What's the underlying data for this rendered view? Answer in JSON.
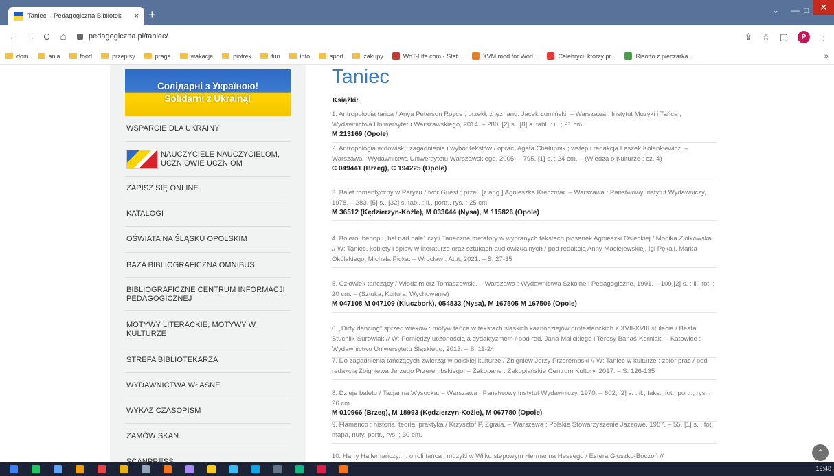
{
  "tab": {
    "title": "Taniec – Pedagogiczna Bibliotek",
    "close": "×",
    "new_tab": "+"
  },
  "window": {
    "minimize": "—",
    "maximize": "□",
    "close": "✕",
    "chevron": "⌄"
  },
  "nav": {
    "back": "←",
    "forward": "→",
    "reload": "C",
    "home": "⌂"
  },
  "address": {
    "url": "pedagogiczna.pl/taniec/"
  },
  "toolbar": {
    "share": "⇪",
    "star": "☆",
    "panel": "▢",
    "profile": "P",
    "menu": "⋮"
  },
  "bookmarks": [
    {
      "label": "dom",
      "type": "folder"
    },
    {
      "label": "ania",
      "type": "folder"
    },
    {
      "label": "food",
      "type": "folder"
    },
    {
      "label": "przepisy",
      "type": "folder"
    },
    {
      "label": "praga",
      "type": "folder"
    },
    {
      "label": "wakacje",
      "type": "folder"
    },
    {
      "label": "piotrek",
      "type": "folder"
    },
    {
      "label": "fun",
      "type": "folder"
    },
    {
      "label": "info",
      "type": "folder"
    },
    {
      "label": "sport",
      "type": "folder"
    },
    {
      "label": "zakupy",
      "type": "folder"
    },
    {
      "label": "WoT-Life.com - Stat...",
      "type": "site",
      "color": "#c0392b"
    },
    {
      "label": "XVM mod for Worl...",
      "type": "site",
      "color": "#e67e22"
    },
    {
      "label": "Celebryci, którzy pr...",
      "type": "site",
      "color": "#e53935"
    },
    {
      "label": "Risotto z pieczarka...",
      "type": "site",
      "color": "#43a047"
    }
  ],
  "bookmarks_more": "»",
  "banner": {
    "line1": "Солідарні з Україною!",
    "line2": "Solidarni z Ukrainą!"
  },
  "menu": [
    {
      "label": "WSPARCIE DLA UKRAINY",
      "h": 38
    },
    {
      "label": "NAUCZYCIELE NAUCZYCIELOM, UCZNIOWIE UCZNIOM",
      "h": 50,
      "flag": true
    },
    {
      "label": "ZAPISZ SIĘ ONLINE",
      "h": 36
    },
    {
      "label": "KATALOGI",
      "h": 37
    },
    {
      "label": "OŚWIATA NA ŚLĄSKU OPOLSKIM",
      "h": 38
    },
    {
      "label": "BAZA BIBLIOGRAFICZNA OMNIBUS",
      "h": 37
    },
    {
      "label": "BIBLIOGRAFICZNE CENTRUM INFORMACJI PEDAGOGICZNEJ",
      "h": 48
    },
    {
      "label": "MOTYWY LITERACKIE, MOTYWY W KULTURZE",
      "h": 54
    },
    {
      "label": "STREFA BIBLIOTEKARZA",
      "h": 36
    },
    {
      "label": "WYDAWNICTWA WŁASNE",
      "h": 37
    },
    {
      "label": "WYKAZ CZASOPISM",
      "h": 37
    },
    {
      "label": "ZAMÓW SKAN",
      "h": 37
    },
    {
      "label": "SCANPRESS",
      "h": 37
    }
  ],
  "content": {
    "title": "Taniec",
    "section": "Książki:",
    "entries": [
      {
        "desc": "1. Antropologia tańca / Anya Peterson Royce ; przekł. z jęz. ang. Jacek Łumiński. – Warszawa : Instytut Muzyki i Tańca ; Wydawnictwa Uniwersytetu Warszawskiego, 2014. – 280, [2] s., [8] s. tabl. : il. ; 21 cm.",
        "sig": "M 213169 (Opole)"
      },
      {
        "desc": "2. Antropologia widowisk : zagadnienia i wybór tekstów / oprac. Agata Chałupnik ; wstęp i redakcja Leszek Kolankiewicz. – Warszawa : Wydawnictwa Uniwersytetu Warszawskiego, 2005. – 795, [1] s. ; 24 cm. – (Wiedza o Kulturze ; cz. 4)",
        "sig": "C 049441 (Brzeg), C 194225 (Opole)"
      },
      {
        "desc": "3. Balet romantyczny w Paryżu / Ivor Guest ; przeł. [z ang.] Agnieszka Kreczmar. – Warszawa : Państwowy Instytut Wydawniczy, 1978. – 283, [5] s., [32] s. tabl. : il., portr., rys. ; 25 cm.",
        "sig": "M 36512 (Kędzierzyn-Koźle), M 033644 (Nysa), M 115826 (Opole)"
      },
      {
        "desc": "4. Bolero, bebop i „bal nad bale” czyli Taneczne metafory w wybranych tekstach piosenek Agnieszki Osieckiej / Monika Ziółkowska // W: Taniec, kobiety i śpiew w literaturze oraz sztukach audiowizualnych / pod redakcją Anny Maciejewskiej, Igi Pękali, Marka Okólskiego, Michała Picka. – Wrocław : Atut, 2021. – S. 27-35",
        "sig": ""
      },
      {
        "desc": "5. Człowiek tańczący / Włodzimierz Tomaszewski. – Warszawa : Wydawnictwa Szkolne i Pedagogiczne, 1991. – 109,[2] s. : il., fot. ; 20 cm. – (Sztuka, Kultura, Wychowanie)",
        "sig": "M 047108 M 047109 (Kluczbork), 054833 (Nysa), M 167505 M 167506 (Opole)"
      },
      {
        "desc": "6. „Dirty dancing” sprzed wieków : motyw tańca w tekstach śląskich kaznodziejów protestanckich z XVII-XVIII stulecia / Beata Stuchlik-Surowiak // W: Pomiędzy uczonością a dydaktyzmem / pod red. Jana Malickiego i Teresy Banaś-Korniak. – Katowice : Wydawnictwo Uniwersytetu Śląskiego, 2013. – S. 11-24",
        "sig": ""
      },
      {
        "desc": "7. Do zagadnienia tańczących zwierząt w polskiej kulturze / Zbigniew Jerzy Przerembski // W: Taniec w kulturze : zbiór prac / pod redakcją Zbigniewa Jerzego Przerembskiego. – Zakopane : Zakopiańskie Centrum Kultury, 2017. – S. 126-135",
        "sig": ""
      },
      {
        "desc": "8. Dzieje baletu / Tacjanna Wysocka. – Warszawa : Państwowy Instytut Wydawniczy, 1970. – 602, [2] s. : il., faks., fot., portr., rys. ; 26 cm.",
        "sig": "M 010966 (Brzeg), M 18993 (Kędzierzyn-Koźle), M 067780 (Opole)"
      },
      {
        "desc": "9. Flamenco : historia, teoria, praktyka / Krzysztof P. Zgraja. – Warszawa : Polskie Stowarzyszenie Jazzowe, 1987. – 55, [1] s. : fot., mapa, nuty, portr., rys. ; 30 cm.",
        "sig": ""
      },
      {
        "desc": "10. Harry Haller tańczy... : o roli tańca i muzyki w Wilku stepowym Hermanna Hessego / Estera Głuszko-Boczoń //",
        "sig": ""
      }
    ]
  },
  "scroll_top": "⌃",
  "tray": {
    "time": "19:48"
  }
}
